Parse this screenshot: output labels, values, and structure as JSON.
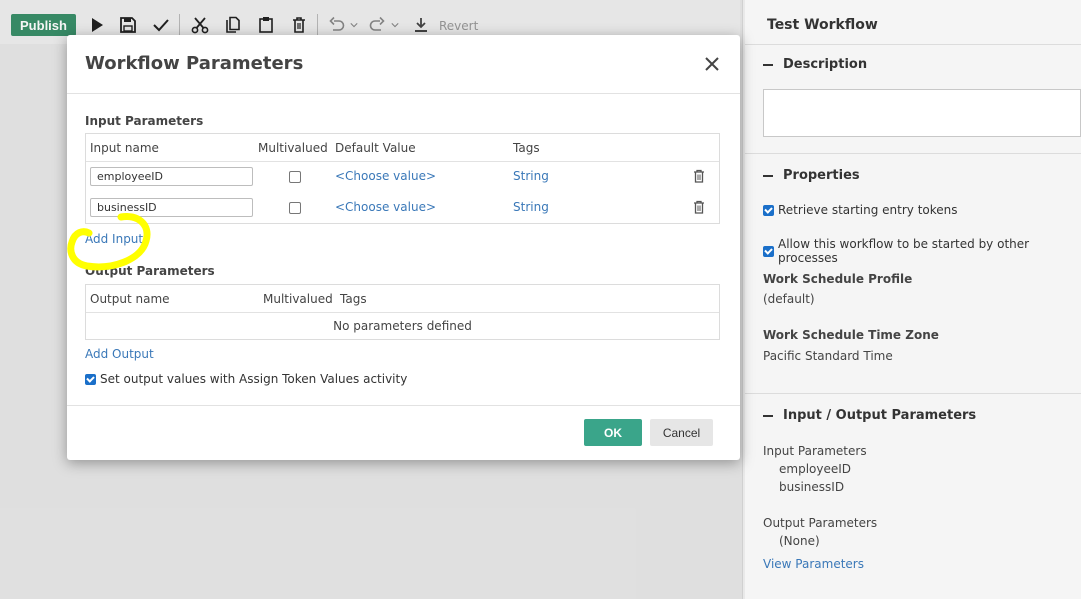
{
  "toolbar": {
    "publish_label": "Publish",
    "icons": [
      "play-icon",
      "save-icon",
      "check-icon",
      "cut-icon",
      "copy-icon",
      "paste-icon",
      "delete-icon",
      "undo-icon",
      "redo-icon",
      "download-icon"
    ],
    "revert_label": "Revert"
  },
  "side_panel": {
    "title": "Test Workflow",
    "description": {
      "heading": "Description",
      "value": ""
    },
    "properties": {
      "heading": "Properties",
      "retrieve_tokens": {
        "label": "Retrieve starting entry tokens",
        "checked": true
      },
      "allow_start": {
        "label": "Allow this workflow to be started by other processes",
        "checked": true
      },
      "schedule_profile": {
        "label": "Work Schedule Profile",
        "value": "(default)"
      },
      "schedule_timezone": {
        "label": "Work Schedule Time Zone",
        "value": "Pacific Standard Time"
      }
    },
    "io": {
      "heading": "Input / Output Parameters",
      "input_label": "Input Parameters",
      "inputs": [
        "employeeID",
        "businessID"
      ],
      "output_label": "Output Parameters",
      "outputs_none": "(None)",
      "view_link": "View Parameters"
    }
  },
  "modal": {
    "title": "Workflow Parameters",
    "input_section": {
      "label": "Input Parameters",
      "headers": {
        "name": "Input name",
        "multivalued": "Multivalued",
        "default": "Default Value",
        "tags": "Tags"
      },
      "rows": [
        {
          "name": "employeeID",
          "multivalued": false,
          "default": "<Choose value>",
          "tags": "String"
        },
        {
          "name": "businessID",
          "multivalued": false,
          "default": "<Choose value>",
          "tags": "String"
        }
      ],
      "add_link": "Add Input"
    },
    "output_section": {
      "label": "Output Parameters",
      "headers": {
        "name": "Output name",
        "multivalued": "Multivalued",
        "tags": "Tags"
      },
      "empty": "No parameters defined",
      "add_link": "Add Output"
    },
    "assign_check": {
      "label": "Set output values with Assign Token Values activity",
      "checked": true
    },
    "ok_label": "OK",
    "cancel_label": "Cancel"
  },
  "colors": {
    "publish": "#3a8f6a",
    "ok": "#3aa58a",
    "link": "#3a78b8",
    "highlight": "#ffff00"
  }
}
